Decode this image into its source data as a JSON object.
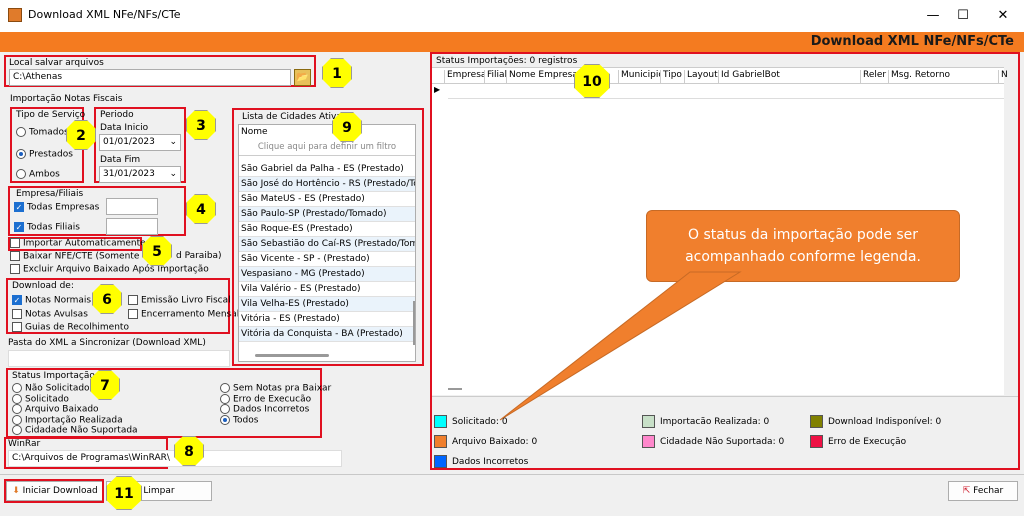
{
  "window": {
    "title": "Download XML NFe/NFs/CTe",
    "minimize": "—",
    "maximize": "☐",
    "close": "✕"
  },
  "banner": {
    "title": "Download XML NFe/NFs/CTe"
  },
  "save_location": {
    "label": "Local salvar arquivos",
    "value": "C:\\Athenas"
  },
  "import_group": {
    "label": "Importação Notas Fiscais"
  },
  "service_type": {
    "label": "Tipo de Serviço",
    "options": [
      "Tomados",
      "Prestados",
      "Ambos"
    ],
    "selected": "Prestados"
  },
  "period": {
    "label": "Periodo",
    "start_label": "Data Inicio",
    "start_value": "01/01/2023",
    "end_label": "Data Fim",
    "end_value": "31/01/2023"
  },
  "companies": {
    "label": "Empresa/Filiais",
    "all_companies": "Todas Empresas",
    "all_branches": "Todas Filiais"
  },
  "options": {
    "auto_import": "Importar Automaticamente",
    "download_nfe": "Baixar NFE/CTE (Somente est",
    "download_nfe_tail": "d Paraiba)",
    "delete_after": "Excluir Arquivo Baixado Após Importação"
  },
  "download_of": {
    "label": "Download de:",
    "normal": "Notas Normais",
    "avulsas": "Notas Avulsas",
    "guias": "Guias de Recolhimento",
    "emissao": "Emissão Livro Fiscal",
    "encerramento": "Encerramento Mensal"
  },
  "sync_path": {
    "label": "Pasta do XML a Sincronizar (Download XML)"
  },
  "status_filter": {
    "label": "Status Importação",
    "left": [
      "Não Solicitado",
      "Solicitado",
      "Arquivo Baixado",
      "Importação Realizada",
      "Cidadade Não Suportada"
    ],
    "right": [
      "Sem Notas pra Baixar",
      "Erro de Execucão",
      "Dados Incorretos",
      "Todos"
    ],
    "selected": "Todos"
  },
  "winrar": {
    "label": "WinRar",
    "value": "C:\\Arquivos de Programas\\WinRAR\\"
  },
  "cities": {
    "label": "Lista de Cidades Ativas",
    "column": "Nome",
    "filter_hint": "Clique aqui para definir um filtro",
    "items": [
      "São Gabriel da Palha - ES (Prestado)",
      "São José do Hortêncio - RS (Prestado/Tom",
      "São MateUS - ES (Prestado)",
      "São Paulo-SP (Prestado/Tomado)",
      "São Roque-ES (Prestado)",
      "São Sebastião do Caí-RS (Prestado/Toma",
      "São Vicente - SP - (Prestado)",
      "Vespasiano - MG (Prestado)",
      "Vila Valério - ES (Prestado)",
      "Vila Velha-ES (Prestado)",
      "Vitória - ES (Prestado)",
      "Vitória da Conquista - BA (Prestado)"
    ]
  },
  "grid": {
    "status": "Status Importações: 0 registros",
    "columns": [
      "Empresa",
      "Filial",
      "Nome Empresa",
      "Municipio",
      "Tipo",
      "Layout",
      "Id GabrielBot",
      "Reler",
      "Msg. Retorno",
      "N"
    ]
  },
  "legend": [
    {
      "label": "Solicitado: 0",
      "color": "#00ffff"
    },
    {
      "label": "Arquivo Baixado: 0",
      "color": "#f07f2d"
    },
    {
      "label": "Dados Incorretos",
      "color": "#0066ff"
    },
    {
      "label": "Importacão Realizada: 0",
      "color": "#c8e0c8"
    },
    {
      "label": "Cidadade Não Suportada: 0",
      "color": "#ff88cc"
    },
    {
      "label": "Download Indisponível: 0",
      "color": "#808000"
    },
    {
      "label": "Erro de Execução",
      "color": "#ee1144"
    }
  ],
  "callout": {
    "text": "O status da importação pode ser acompanhado conforme legenda."
  },
  "buttons": {
    "start": "Iniciar Download",
    "clear": "Limpar",
    "close": "Fechar"
  },
  "badges": [
    "1",
    "2",
    "3",
    "4",
    "5",
    "6",
    "7",
    "8",
    "9",
    "10",
    "11"
  ]
}
